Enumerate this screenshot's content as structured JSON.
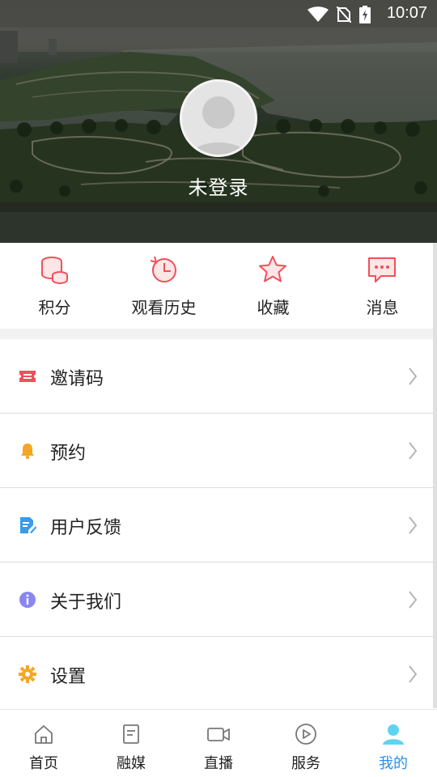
{
  "status_bar": {
    "time": "10:07"
  },
  "profile": {
    "login_status": "未登录"
  },
  "quick_actions": [
    {
      "id": "points",
      "label": "积分",
      "icon": "coin-stack-icon"
    },
    {
      "id": "history",
      "label": "观看历史",
      "icon": "history-clock-icon"
    },
    {
      "id": "favorites",
      "label": "收藏",
      "icon": "star-icon"
    },
    {
      "id": "messages",
      "label": "消息",
      "icon": "message-bubble-icon"
    }
  ],
  "menu": [
    {
      "id": "invite-code",
      "label": "邀请码",
      "icon": "ticket-icon",
      "icon_color": "#f0505a"
    },
    {
      "id": "reservation",
      "label": "预约",
      "icon": "bell-icon",
      "icon_color": "#f5a623"
    },
    {
      "id": "feedback",
      "label": "用户反馈",
      "icon": "edit-document-icon",
      "icon_color": "#3a9bea"
    },
    {
      "id": "about",
      "label": "关于我们",
      "icon": "info-icon",
      "icon_color": "#8a86f0"
    },
    {
      "id": "settings",
      "label": "设置",
      "icon": "gear-icon",
      "icon_color": "#f5a623"
    }
  ],
  "bottom_nav": [
    {
      "id": "home",
      "label": "首页",
      "icon": "home-icon",
      "active": false
    },
    {
      "id": "media",
      "label": "融媒",
      "icon": "document-icon",
      "active": false
    },
    {
      "id": "live",
      "label": "直播",
      "icon": "video-camera-icon",
      "active": false
    },
    {
      "id": "services",
      "label": "服务",
      "icon": "play-circle-icon",
      "active": false
    },
    {
      "id": "mine",
      "label": "我的",
      "icon": "person-icon",
      "active": true
    }
  ],
  "colors": {
    "accent": "#2b8fe8",
    "quick_icon": "#f0505a"
  }
}
